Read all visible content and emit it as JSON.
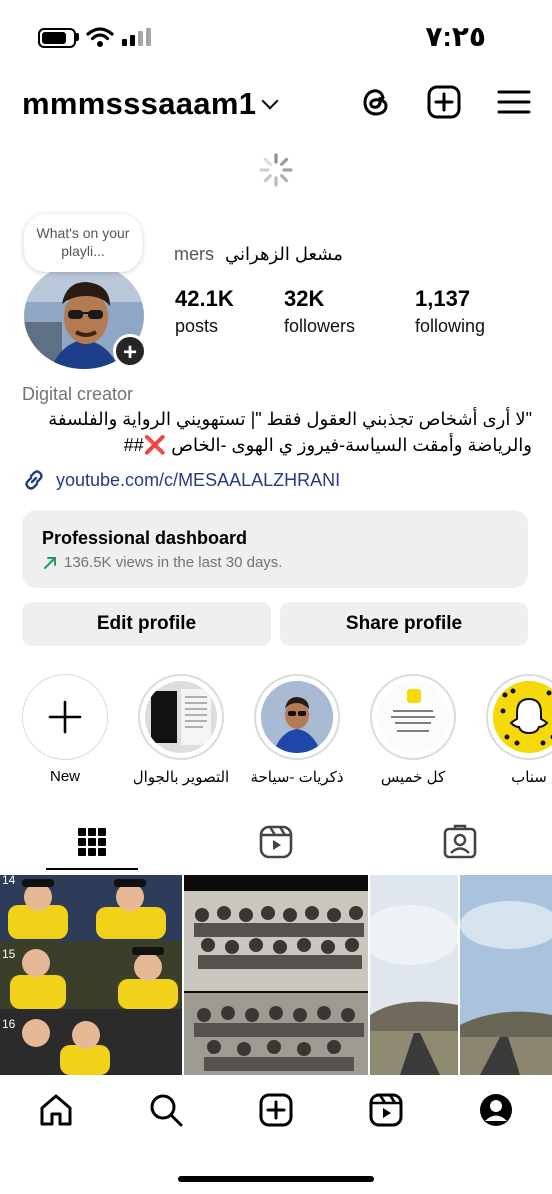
{
  "status_bar": {
    "time": "٧:٢٥"
  },
  "header": {
    "username": "mmmsssaaam1"
  },
  "profile": {
    "note_bubble": "What's on your playli...",
    "display_name_latin": "mers",
    "display_name_arabic": "مشعل الزهراني",
    "stats": [
      {
        "value": "42.1K",
        "label": "posts"
      },
      {
        "value": "32K",
        "label": "followers"
      },
      {
        "value": "1,137",
        "label": "following"
      }
    ],
    "category": "Digital creator",
    "bio_line1": "\"لا أرى أشخاص تجذبني العقول فقط \"| تستهويني الرواية والفلسفة",
    "bio_line2": "والرياضة وأمقت السياسة-فيروز ي الهوى -الخاص ❌##",
    "link": "youtube.com/c/MESAALALZHRANI"
  },
  "dashboard": {
    "title": "Professional dashboard",
    "subtitle": "136.5K views in the last 30 days."
  },
  "actions": {
    "edit_label": "Edit profile",
    "share_label": "Share profile"
  },
  "highlights": [
    {
      "label": "New"
    },
    {
      "label": "التصوير بالجوال"
    },
    {
      "label": "ذكريات -سياحة"
    },
    {
      "label": "كل خميس"
    },
    {
      "label": "سناب"
    }
  ],
  "grid": {
    "numbers": [
      "14",
      "15",
      "16"
    ]
  },
  "colors": {
    "link": "#233c83",
    "muted": "#737373",
    "button_bg": "#efefef",
    "snap_yellow": "#f5d90a",
    "growth_arrow": "#1a9e5a"
  },
  "icons": [
    "threads-icon",
    "create-post-icon",
    "menu-icon",
    "grid-icon",
    "reels-icon",
    "tagged-icon",
    "home-icon",
    "search-icon",
    "add-icon",
    "reels-nav-icon",
    "profile-icon"
  ]
}
